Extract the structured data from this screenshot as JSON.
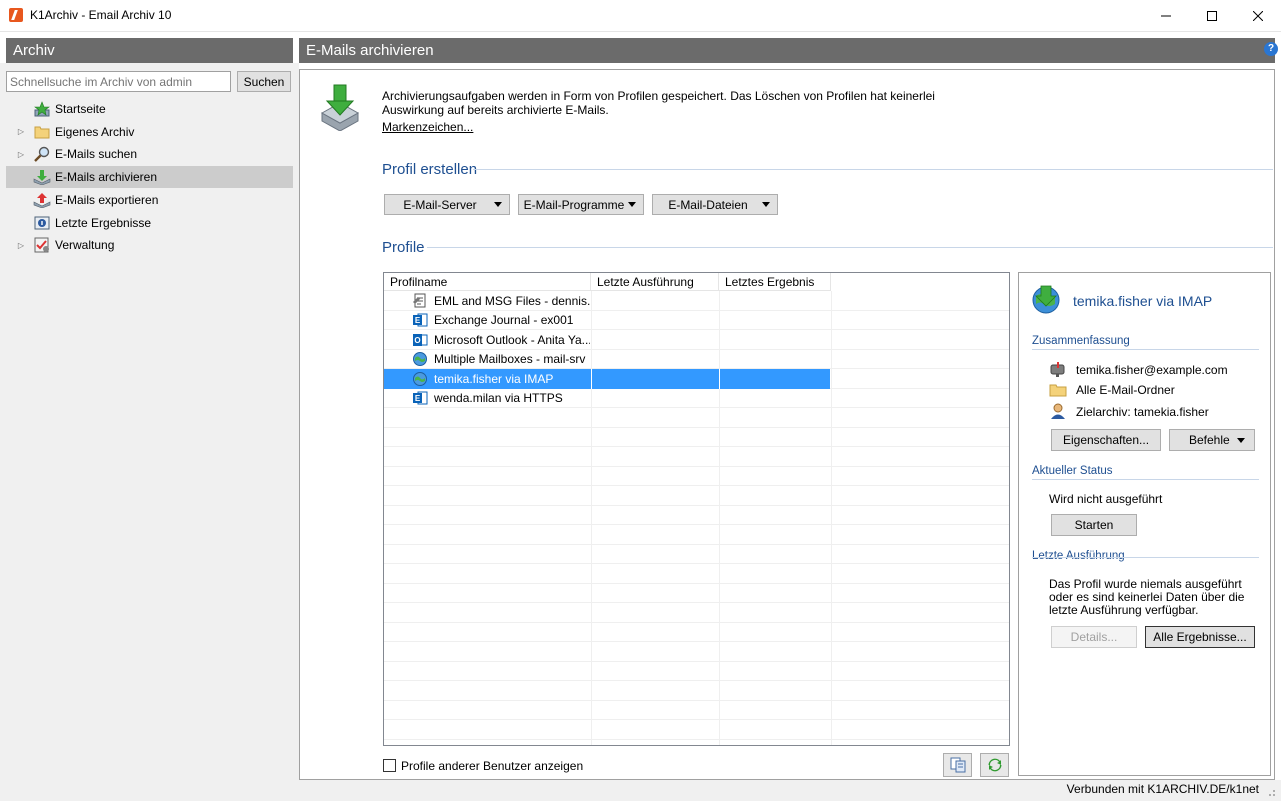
{
  "window": {
    "title": "K1Archiv - Email Archiv 10",
    "minimize": "—",
    "maximize": "☐",
    "close": "✕"
  },
  "left": {
    "header": "Archiv",
    "search_placeholder": "Schnellsuche im Archiv von admin",
    "search_button": "Suchen",
    "items": [
      {
        "label": "Startseite",
        "icon": "star-icon",
        "expandable": false,
        "selected": false
      },
      {
        "label": "Eigenes Archiv",
        "icon": "folder-icon",
        "expandable": true,
        "selected": false
      },
      {
        "label": "E-Mails suchen",
        "icon": "magnifier-icon",
        "expandable": true,
        "selected": false
      },
      {
        "label": "E-Mails archivieren",
        "icon": "archive-icon",
        "expandable": false,
        "selected": true
      },
      {
        "label": "E-Mails exportieren",
        "icon": "export-icon",
        "expandable": false,
        "selected": false
      },
      {
        "label": "Letzte Ergebnisse",
        "icon": "results-icon",
        "expandable": false,
        "selected": false
      },
      {
        "label": "Verwaltung",
        "icon": "admin-icon",
        "expandable": true,
        "selected": false
      }
    ]
  },
  "main": {
    "header": "E-Mails archivieren",
    "intro": "Archivierungsaufgaben werden in Form von Profilen gespeichert. Das Löschen von Profilen hat keinerlei Auswirkung auf bereits archivierte E-Mails.",
    "trademark_link": "Markenzeichen...",
    "create_section": "Profil erstellen",
    "create_buttons": [
      "E-Mail-Server",
      "E-Mail-Programme",
      "E-Mail-Dateien"
    ],
    "profiles_section": "Profile",
    "columns": [
      "Profilname",
      "Letzte Ausführung",
      "Letztes Ergebnis"
    ],
    "profiles": [
      {
        "name": "EML and MSG Files - dennis....",
        "icon": "files-icon",
        "selected": false
      },
      {
        "name": "Exchange Journal - ex001",
        "icon": "exchange-icon",
        "selected": false
      },
      {
        "name": "Microsoft Outlook - Anita Ya...",
        "icon": "outlook-icon",
        "selected": false
      },
      {
        "name": "Multiple Mailboxes - mail-srv",
        "icon": "globe-icon",
        "selected": false
      },
      {
        "name": "temika.fisher via IMAP",
        "icon": "globe-icon",
        "selected": true
      },
      {
        "name": "wenda.milan via HTTPS",
        "icon": "exchange-icon",
        "selected": false
      }
    ],
    "show_others_label": "Profile anderer Benutzer anzeigen"
  },
  "detail": {
    "title": "temika.fisher via IMAP",
    "summary_section": "Zusammenfassung",
    "email": "temika.fisher@example.com",
    "folders": "Alle E-Mail-Ordner",
    "target": "Zielarchiv: tamekia.fisher",
    "properties_button": "Eigenschaften...",
    "commands_button": "Befehle",
    "status_section": "Aktueller Status",
    "status_text": "Wird nicht ausgeführt",
    "start_button": "Starten",
    "last_section": "Letzte Ausführung",
    "last_text": "Das Profil wurde niemals ausgeführt oder es sind keinerlei Daten über die letzte Ausführung verfügbar.",
    "details_button": "Details...",
    "all_results_button": "Alle Ergebnisse..."
  },
  "status": {
    "text": "Verbunden mit K1ARCHIV.DE/k1net"
  },
  "colors": {
    "header_gray": "#6b6b6b",
    "selection_blue": "#3399ff",
    "section_blue": "#1e4f91"
  }
}
